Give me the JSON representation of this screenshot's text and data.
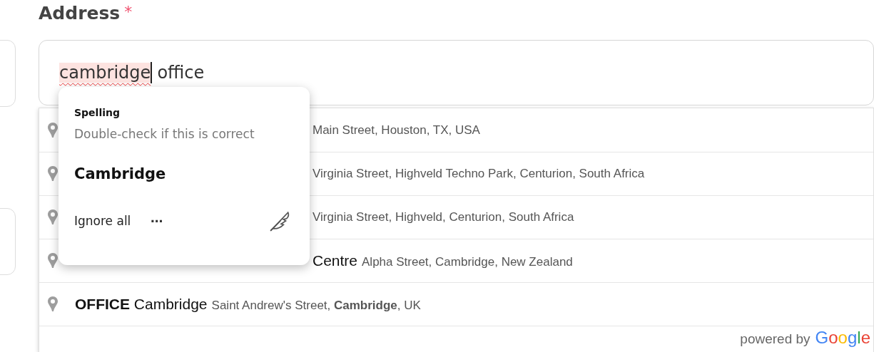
{
  "field": {
    "label": "Address",
    "required_mark": "*",
    "value": [
      {
        "text": "cambridge",
        "misspelled": true,
        "caret_after": true
      },
      {
        "text": " office",
        "misspelled": false,
        "caret_after": false
      }
    ]
  },
  "suggestions": [
    {
      "kind": "covered",
      "secondary": "Main Street, Houston, TX, USA"
    },
    {
      "kind": "covered",
      "secondary": "Virginia Street, Highveld Techno Park, Centurion, South Africa"
    },
    {
      "kind": "covered",
      "secondary": "Virginia Street, Highveld, Centurion, South Africa"
    },
    {
      "kind": "covered",
      "main": "Centre",
      "secondary": "Alpha Street, Cambridge, New Zealand"
    },
    {
      "kind": "full",
      "main": "**OFFICE** Cambridge",
      "secondary": "Saint Andrew's Street, **Cambridge**, UK"
    }
  ],
  "attribution": {
    "prefix": "powered by",
    "brand": "Google"
  },
  "spelling_popup": {
    "heading": "Spelling",
    "hint": "Double-check if this is correct",
    "suggestion": "Cambridge",
    "ignore": "Ignore all",
    "more": "⋯"
  }
}
